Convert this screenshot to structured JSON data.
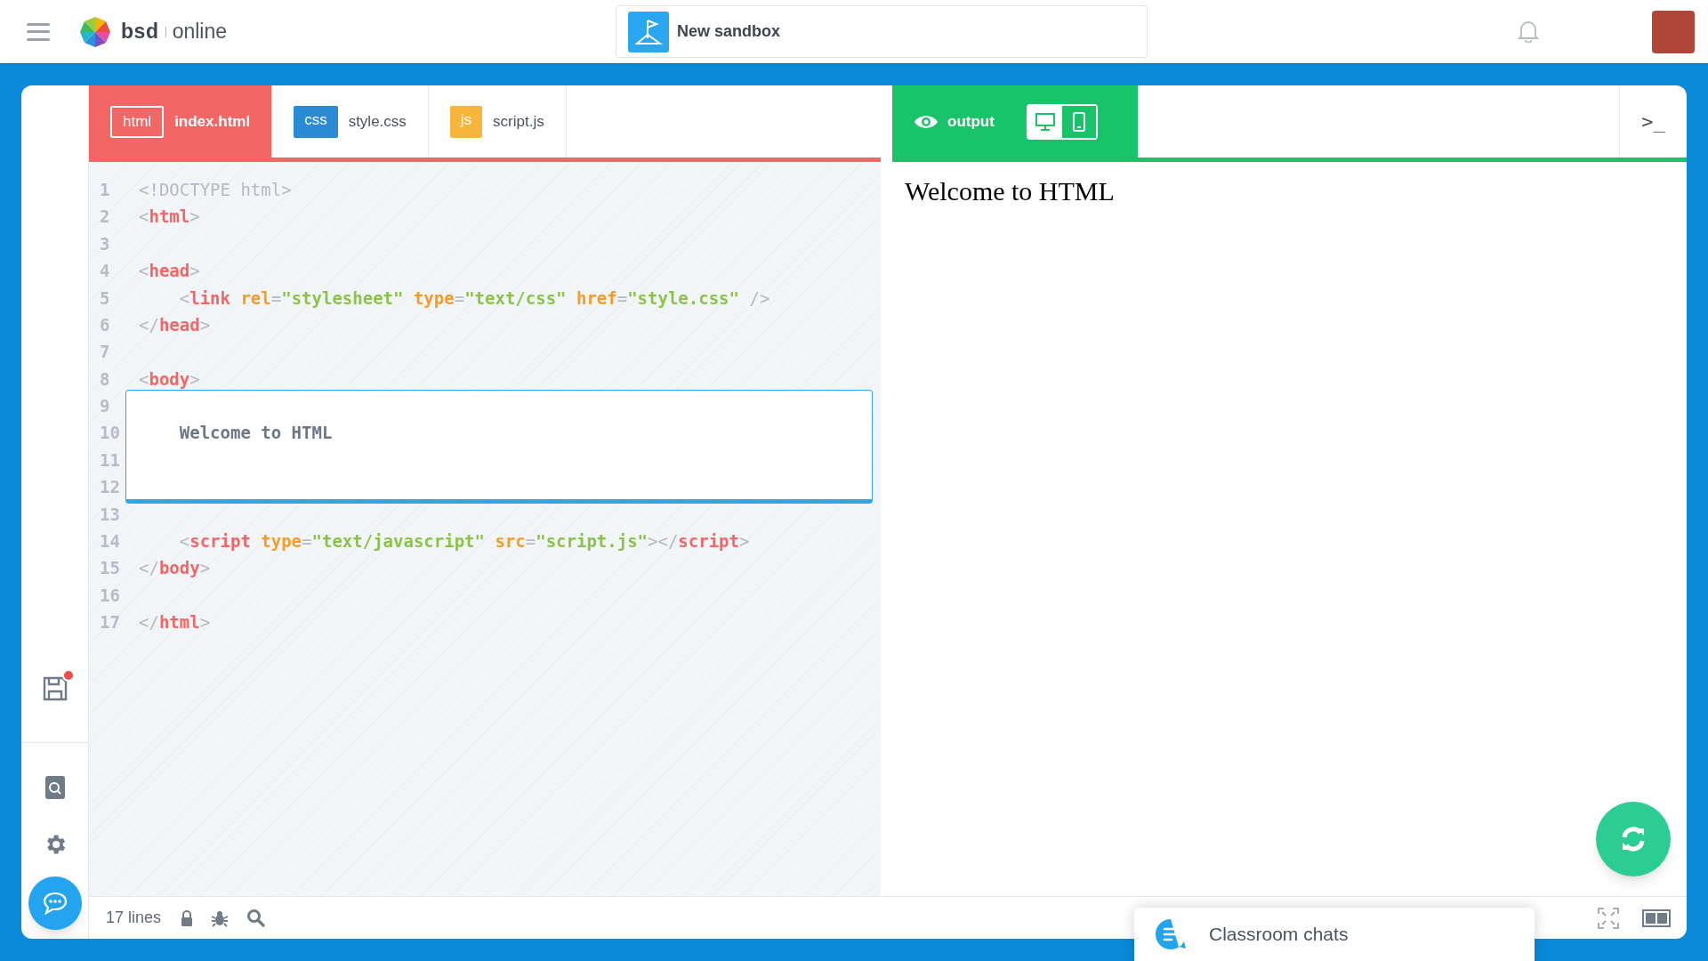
{
  "topbar": {
    "brand": "bsd",
    "brand_suffix": "online",
    "sandbox_title": "New sandbox"
  },
  "editor_tabs": [
    {
      "kind": "html",
      "badge": "html",
      "label": "index.html",
      "selected": true
    },
    {
      "kind": "css",
      "badge": "css",
      "label": "style.css",
      "selected": false
    },
    {
      "kind": "js",
      "badge": "js",
      "label": "script.js",
      "selected": false
    }
  ],
  "output_header": {
    "label": "output",
    "views": [
      {
        "kind": "desktop",
        "selected": true
      },
      {
        "kind": "mobile",
        "selected": false
      }
    ],
    "terminal": ">_"
  },
  "code_lines": [
    {
      "number": "1",
      "highlighted": false,
      "tokens": [
        {
          "kind": "meta",
          "text": "<!DOCTYPE html>"
        }
      ]
    },
    {
      "number": "2",
      "highlighted": false,
      "tokens": [
        {
          "kind": "punct",
          "text": "<"
        },
        {
          "kind": "tag",
          "text": "html"
        },
        {
          "kind": "punct",
          "text": ">"
        }
      ]
    },
    {
      "number": "3",
      "highlighted": false
    },
    {
      "number": "4",
      "highlighted": false,
      "tokens": [
        {
          "kind": "punct",
          "text": "<"
        },
        {
          "kind": "tag",
          "text": "head"
        },
        {
          "kind": "punct",
          "text": ">"
        }
      ]
    },
    {
      "number": "5",
      "highlighted": false,
      "tokens": [
        {
          "kind": "punct",
          "text": "    <"
        },
        {
          "kind": "tag",
          "text": "link"
        },
        {
          "kind": "attr",
          "text": " rel"
        },
        {
          "kind": "punct",
          "text": "="
        },
        {
          "kind": "string",
          "text": "\"stylesheet\""
        },
        {
          "kind": "attr",
          "text": " type"
        },
        {
          "kind": "punct",
          "text": "="
        },
        {
          "kind": "string",
          "text": "\"text/css\""
        },
        {
          "kind": "attr",
          "text": " href"
        },
        {
          "kind": "punct",
          "text": "="
        },
        {
          "kind": "string",
          "text": "\"style.css\""
        },
        {
          "kind": "punct",
          "text": " />"
        }
      ]
    },
    {
      "number": "6",
      "highlighted": false,
      "tokens": [
        {
          "kind": "punct",
          "text": "</"
        },
        {
          "kind": "tag",
          "text": "head"
        },
        {
          "kind": "punct",
          "text": ">"
        }
      ]
    },
    {
      "number": "7",
      "highlighted": false
    },
    {
      "number": "8",
      "highlighted": false,
      "tokens": [
        {
          "kind": "punct",
          "text": "<"
        },
        {
          "kind": "tag",
          "text": "body"
        },
        {
          "kind": "punct",
          "text": ">"
        }
      ]
    },
    {
      "number": "9",
      "highlighted": true
    },
    {
      "number": "10",
      "highlighted": true,
      "tokens": [
        {
          "kind": "text",
          "text": "    Welcome to HTML"
        }
      ]
    },
    {
      "number": "11",
      "highlighted": true
    },
    {
      "number": "12",
      "highlighted": true
    },
    {
      "number": "13",
      "highlighted": false
    },
    {
      "number": "14",
      "highlighted": false,
      "tokens": [
        {
          "kind": "punct",
          "text": "    <"
        },
        {
          "kind": "tag",
          "text": "script"
        },
        {
          "kind": "attr",
          "text": " type"
        },
        {
          "kind": "punct",
          "text": "="
        },
        {
          "kind": "string",
          "text": "\"text/javascript\""
        },
        {
          "kind": "attr",
          "text": " src"
        },
        {
          "kind": "punct",
          "text": "="
        },
        {
          "kind": "string",
          "text": "\"script.js\""
        },
        {
          "kind": "punct",
          "text": "></"
        },
        {
          "kind": "tag",
          "text": "script"
        },
        {
          "kind": "punct",
          "text": ">"
        }
      ]
    },
    {
      "number": "15",
      "highlighted": false,
      "tokens": [
        {
          "kind": "punct",
          "text": "</"
        },
        {
          "kind": "tag",
          "text": "body"
        },
        {
          "kind": "punct",
          "text": ">"
        }
      ]
    },
    {
      "number": "16",
      "highlighted": false
    },
    {
      "number": "17",
      "highlighted": false,
      "tokens": [
        {
          "kind": "punct",
          "text": "</"
        },
        {
          "kind": "tag",
          "text": "html"
        },
        {
          "kind": "punct",
          "text": ">"
        }
      ]
    }
  ],
  "output_text": "Welcome to HTML",
  "status_bar": {
    "line_count": "17 lines"
  },
  "chat_panel": {
    "title": "Classroom chats"
  }
}
